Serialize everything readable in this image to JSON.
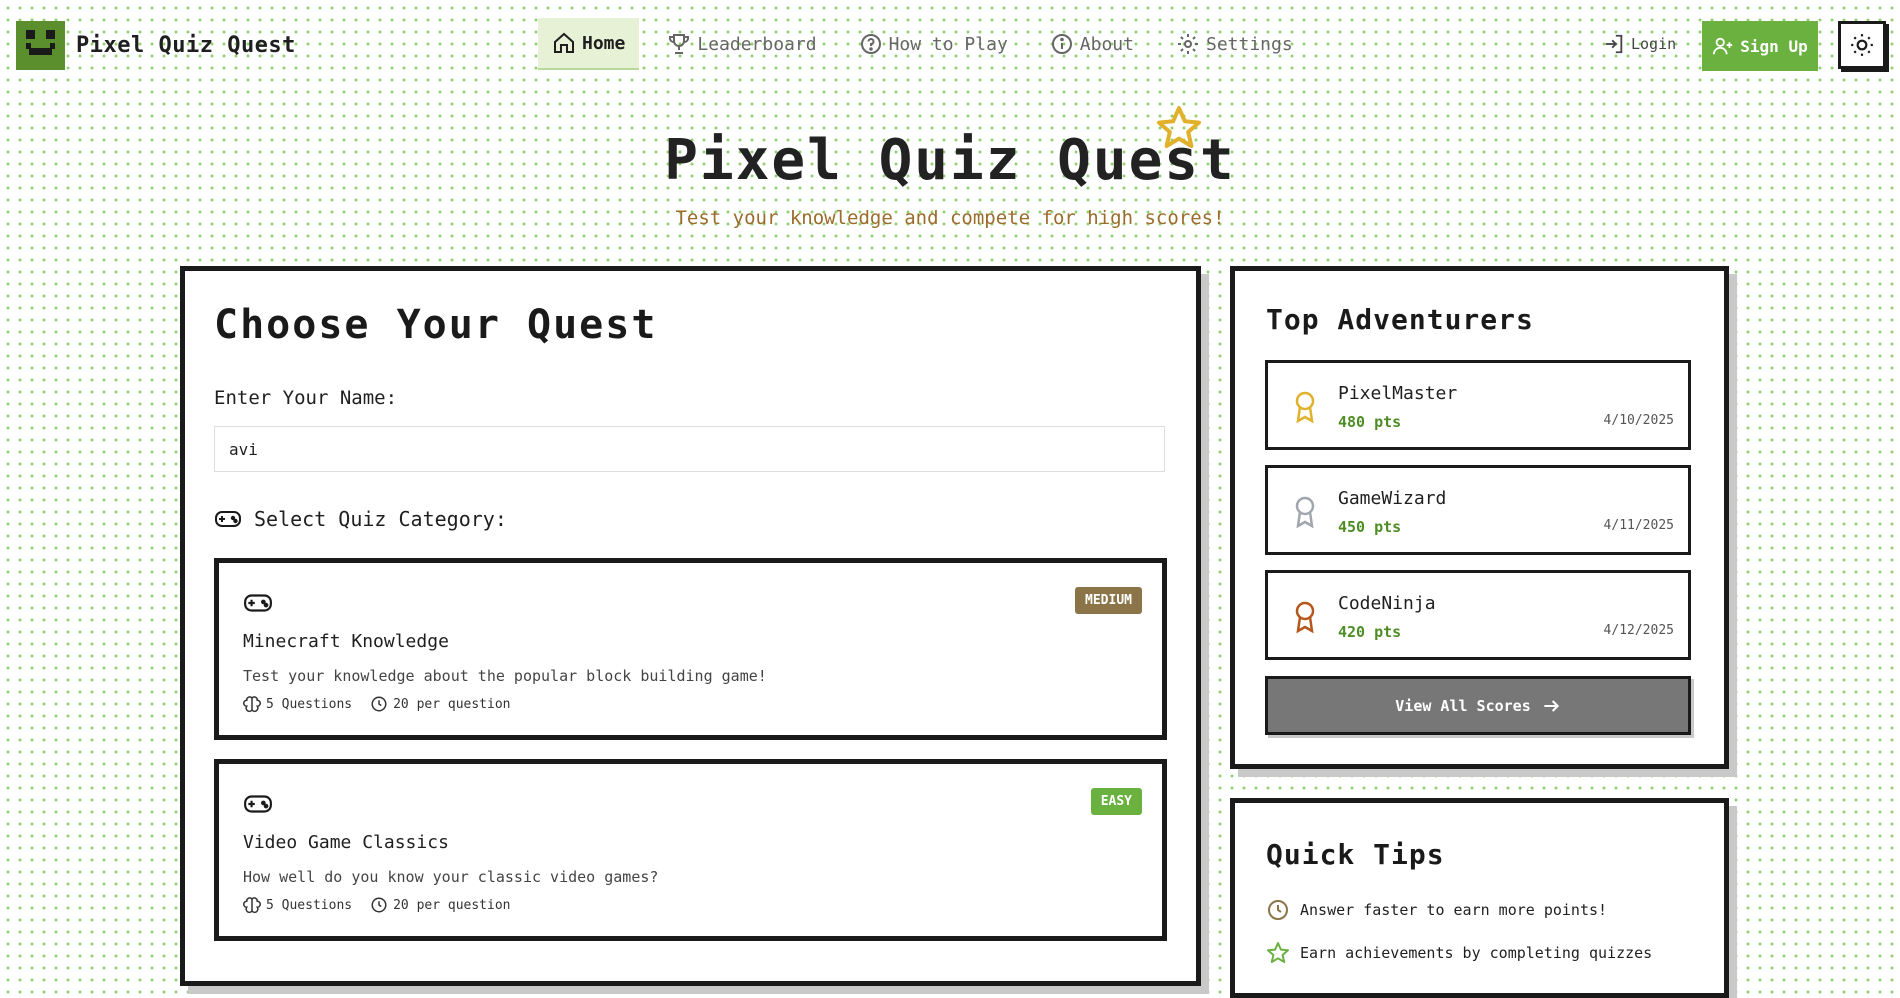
{
  "header": {
    "brand": "Pixel Quiz Quest",
    "nav": [
      {
        "label": "Home",
        "icon": "home-icon",
        "active": true
      },
      {
        "label": "Leaderboard",
        "icon": "trophy-icon",
        "active": false
      },
      {
        "label": "How to Play",
        "icon": "help-circle-icon",
        "active": false
      },
      {
        "label": "About",
        "icon": "info-icon",
        "active": false
      },
      {
        "label": "Settings",
        "icon": "gear-icon",
        "active": false
      }
    ],
    "login_label": "Login",
    "signup_label": "Sign Up"
  },
  "hero": {
    "title": "Pixel Quiz Quest",
    "subtitle": "Test your knowledge and compete for high scores!"
  },
  "quest": {
    "title": "Choose Your Quest",
    "name_label": "Enter Your Name:",
    "name_value": "avi",
    "category_label": "Select Quiz Category:",
    "cards": [
      {
        "title": "Minecraft Knowledge",
        "description": "Test your knowledge about the popular block building game!",
        "difficulty": "MEDIUM",
        "difficulty_color": "#8b7548",
        "questions": "5 Questions",
        "time": "20 per question"
      },
      {
        "title": "Video Game Classics",
        "description": "How well do you know your classic video games?",
        "difficulty": "EASY",
        "difficulty_color": "#6ab13f",
        "questions": "5 Questions",
        "time": "20 per question"
      }
    ]
  },
  "leaderboard": {
    "title": "Top Adventurers",
    "entries": [
      {
        "name": "PixelMaster",
        "points": "480 pts",
        "date": "4/10/2025",
        "medal_color": "#e1b12c"
      },
      {
        "name": "GameWizard",
        "points": "450 pts",
        "date": "4/11/2025",
        "medal_color": "#a0a6ad"
      },
      {
        "name": "CodeNinja",
        "points": "420 pts",
        "date": "4/12/2025",
        "medal_color": "#b5561c"
      }
    ],
    "view_all_label": "View All Scores"
  },
  "tips": {
    "title": "Quick Tips",
    "items": [
      {
        "text": "Answer faster to earn more points!",
        "icon": "clock-icon",
        "color": "#8b7548"
      },
      {
        "text": "Earn achievements by completing quizzes",
        "icon": "star-icon",
        "color": "#6ab13f"
      }
    ]
  },
  "colors": {
    "accent_green": "#6ab13f",
    "subtitle_brown": "#9b6b2a",
    "star_gold": "#e1b12c"
  }
}
